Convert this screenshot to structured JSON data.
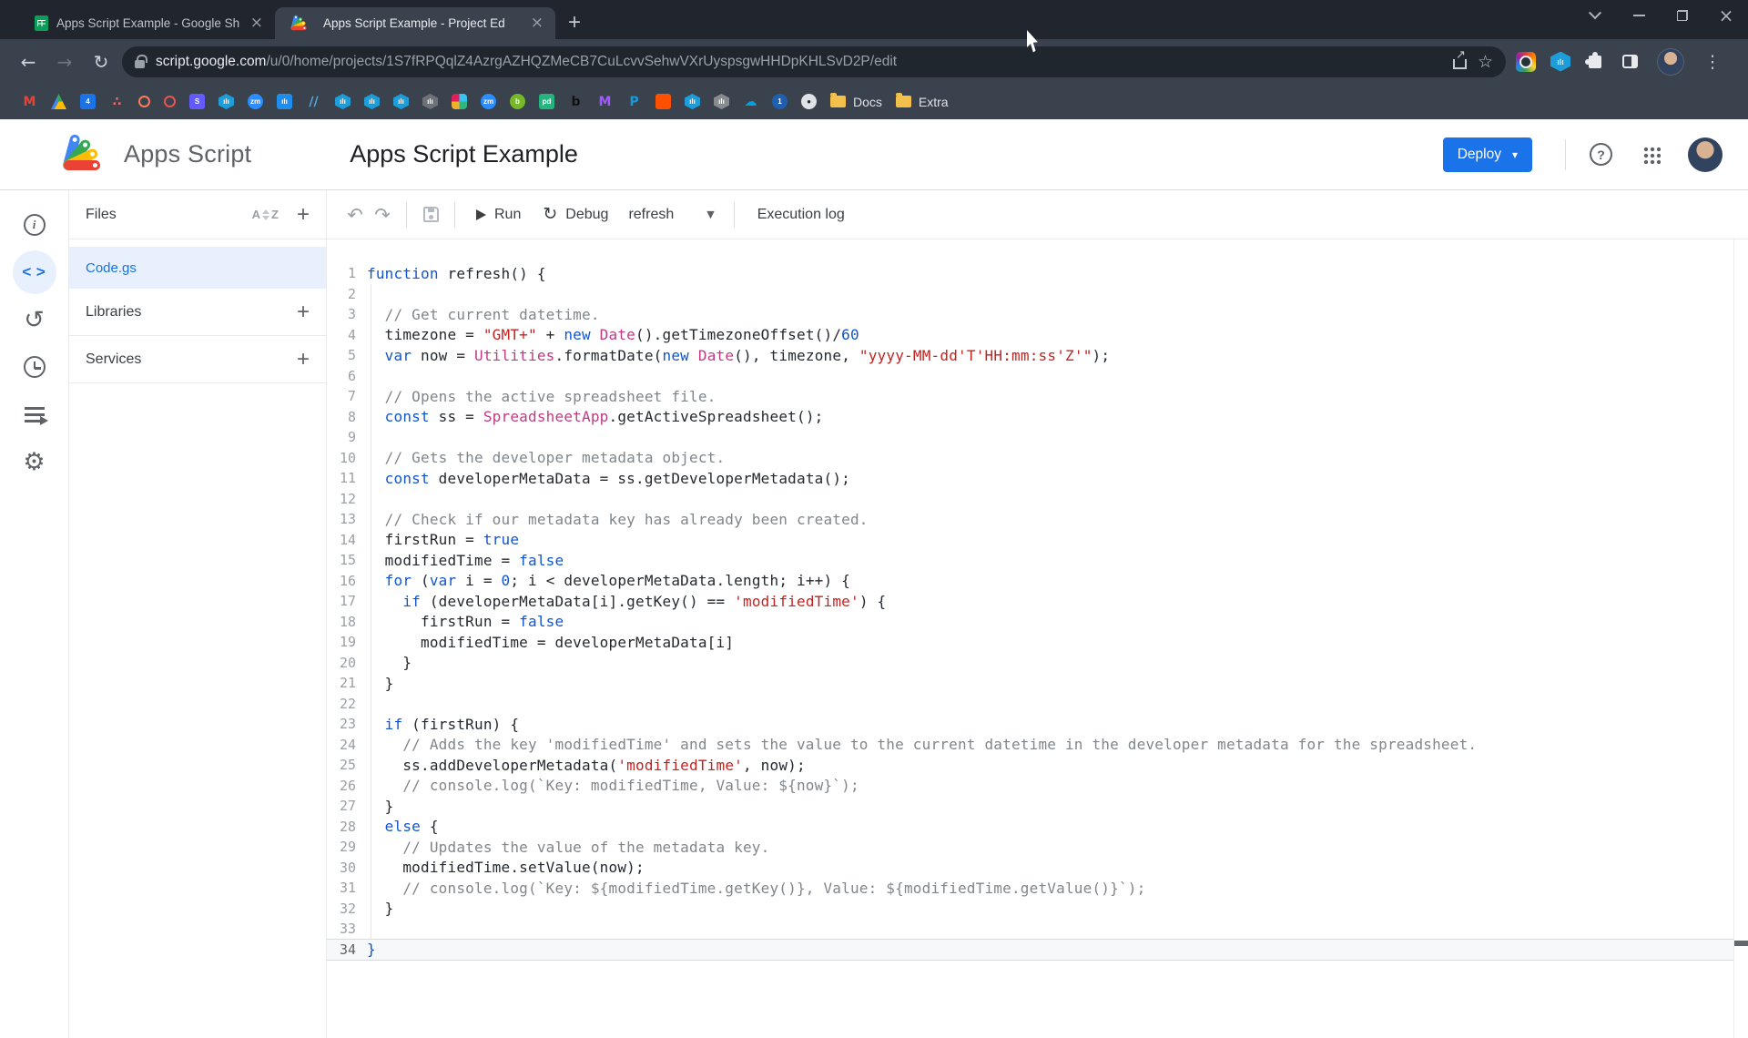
{
  "browser": {
    "tabs": [
      {
        "title": "Apps Script Example - Google Sh",
        "favicon": "google-sheets"
      },
      {
        "title": "Apps Script Example - Project Ed",
        "favicon": "apps-script",
        "active": true
      }
    ],
    "url_domain": "script.google.com",
    "url_path": "/u/0/home/projects/1S7fRPQqlZ4AzrgAZHQZMeCB7CuLcvvSehwVXrUyspsgwHHDpKHLSvD2P/edit",
    "bookmarks": [
      {
        "name": "gmail-bookmark",
        "shape": "glyphonly",
        "glyph": "M",
        "color": "#ea4335"
      },
      {
        "name": "drive-bookmark",
        "shape": "tri"
      },
      {
        "name": "calendar-bookmark",
        "shape": "square",
        "bg": "#1a73e8",
        "glyph": "4",
        "color": "#fff"
      },
      {
        "name": "asana-bookmark",
        "shape": "glyphonly",
        "glyph": "∴",
        "color": "#f06a6a"
      },
      {
        "name": "hubspot-bookmark",
        "shape": "ring",
        "border": "#ff7a59"
      },
      {
        "name": "sprocket-bookmark",
        "shape": "ring",
        "border": "#e8544f"
      },
      {
        "name": "stripe-bookmark",
        "shape": "square",
        "bg": "#635bff",
        "glyph": "S",
        "color": "#fff"
      },
      {
        "name": "databox-bookmark",
        "shape": "hex",
        "bg": "#1d9dd9",
        "glyph": "ılı",
        "color": "#fff"
      },
      {
        "name": "zoom-bookmark",
        "shape": "circle",
        "bg": "#2d8cff",
        "glyph": "zm",
        "color": "#fff"
      },
      {
        "name": "intercom-bookmark",
        "shape": "square",
        "bg": "#1f8ded",
        "glyph": "ılı",
        "color": "#fff"
      },
      {
        "name": "stripes-bookmark",
        "shape": "glyphonly",
        "glyph": "∕∕",
        "color": "#57a8dc"
      },
      {
        "name": "databox-bookmark",
        "shape": "hex",
        "bg": "#1d9dd9",
        "glyph": "ılı",
        "color": "#fff"
      },
      {
        "name": "databox-bookmark",
        "shape": "hex",
        "bg": "#1d9dd9",
        "glyph": "ılı",
        "color": "#fff"
      },
      {
        "name": "databox-bookmark",
        "shape": "hex",
        "bg": "#1d9dd9",
        "glyph": "ılı",
        "color": "#fff"
      },
      {
        "name": "databox-gray-bookmark",
        "shape": "hex",
        "bg": "#6d7278",
        "glyph": "ılı",
        "color": "#fff"
      },
      {
        "name": "slack-bookmark",
        "shape": "slack"
      },
      {
        "name": "zoom-bookmark",
        "shape": "circle",
        "bg": "#2d8cff",
        "glyph": "zm",
        "color": "#fff"
      },
      {
        "name": "basecamp-bookmark",
        "shape": "circle",
        "bg": "#76b82a",
        "glyph": "b",
        "color": "#fff"
      },
      {
        "name": "pandadoc-bookmark",
        "shape": "square",
        "bg": "#24b47e",
        "glyph": "pd",
        "color": "#fff"
      },
      {
        "name": "script-letter-bookmark",
        "shape": "glyphonly",
        "glyph": "b",
        "color": "#111111"
      },
      {
        "name": "monday-bookmark",
        "shape": "glyphonly",
        "glyph": "M",
        "color": "#a259ff"
      },
      {
        "name": "paypal-bookmark",
        "shape": "glyphonly",
        "glyph": "P",
        "color": "#169bd7"
      },
      {
        "name": "orange-square-bookmark",
        "shape": "square",
        "bg": "#ff4f00"
      },
      {
        "name": "databox-bookmark",
        "shape": "hex",
        "bg": "#1d9dd9",
        "glyph": "ılı",
        "color": "#fff"
      },
      {
        "name": "databox-gray-bookmark",
        "shape": "hex",
        "bg": "#878c91",
        "glyph": "ılı",
        "color": "#fff"
      },
      {
        "name": "salesforce-bookmark",
        "shape": "glyphonly",
        "glyph": "☁",
        "color": "#00a1e0"
      },
      {
        "name": "onepassword-bookmark",
        "shape": "circle",
        "bg": "#1f5fae",
        "glyph": "1",
        "color": "#fff"
      },
      {
        "name": "github-bookmark",
        "shape": "circle",
        "bg": "#dfe3e7",
        "glyph": "●",
        "color": "#24292f"
      },
      {
        "name": "docs-folder",
        "shape": "folder",
        "label": "Docs"
      },
      {
        "name": "extra-folder",
        "shape": "folder",
        "label": "Extra"
      }
    ]
  },
  "header": {
    "product": "Apps Script",
    "project_title": "Apps Script Example",
    "deploy_label": "Deploy"
  },
  "sidebar": {
    "files_label": "Files",
    "files": [
      {
        "name": "Code.gs",
        "selected": true
      }
    ],
    "libraries_label": "Libraries",
    "services_label": "Services"
  },
  "toolbar": {
    "run_label": "Run",
    "debug_label": "Debug",
    "function_selector": "refresh",
    "execution_log_label": "Execution log"
  },
  "editor": {
    "current_line": 34,
    "lines": [
      [
        [
          "kw",
          "function"
        ],
        [
          "d",
          " refresh() {"
        ]
      ],
      [],
      [
        [
          "c",
          "  // Get current datetime."
        ]
      ],
      [
        [
          "d",
          "  timezone = "
        ],
        [
          "s",
          "\"GMT+\""
        ],
        [
          "d",
          " + "
        ],
        [
          "kw",
          "new"
        ],
        [
          "d",
          " "
        ],
        [
          "t",
          "Date"
        ],
        [
          "d",
          "().getTimezoneOffset()/"
        ],
        [
          "n",
          "60"
        ]
      ],
      [
        [
          "d",
          "  "
        ],
        [
          "kw",
          "var"
        ],
        [
          "d",
          " now = "
        ],
        [
          "t",
          "Utilities"
        ],
        [
          "d",
          ".formatDate("
        ],
        [
          "kw",
          "new"
        ],
        [
          "d",
          " "
        ],
        [
          "t",
          "Date"
        ],
        [
          "d",
          "(), timezone, "
        ],
        [
          "s",
          "\"yyyy-MM-dd'T'HH:mm:ss'Z'\""
        ],
        [
          "d",
          ");"
        ]
      ],
      [],
      [
        [
          "c",
          "  // Opens the active spreadsheet file."
        ]
      ],
      [
        [
          "d",
          "  "
        ],
        [
          "kw",
          "const"
        ],
        [
          "d",
          " ss = "
        ],
        [
          "t",
          "SpreadsheetApp"
        ],
        [
          "d",
          ".getActiveSpreadsheet();"
        ]
      ],
      [],
      [
        [
          "c",
          "  // Gets the developer metadata object."
        ]
      ],
      [
        [
          "d",
          "  "
        ],
        [
          "kw",
          "const"
        ],
        [
          "d",
          " developerMetaData = ss.getDeveloperMetadata();"
        ]
      ],
      [],
      [
        [
          "c",
          "  // Check if our metadata key has already been created."
        ]
      ],
      [
        [
          "d",
          "  firstRun = "
        ],
        [
          "kw",
          "true"
        ]
      ],
      [
        [
          "d",
          "  modifiedTime = "
        ],
        [
          "kw",
          "false"
        ]
      ],
      [
        [
          "d",
          "  "
        ],
        [
          "kw",
          "for"
        ],
        [
          "d",
          " ("
        ],
        [
          "kw",
          "var"
        ],
        [
          "d",
          " i = "
        ],
        [
          "n",
          "0"
        ],
        [
          "d",
          "; i < developerMetaData.length; i++) {"
        ]
      ],
      [
        [
          "d",
          "    "
        ],
        [
          "kw",
          "if"
        ],
        [
          "d",
          " (developerMetaData[i].getKey() == "
        ],
        [
          "s",
          "'modifiedTime'"
        ],
        [
          "d",
          ") {"
        ]
      ],
      [
        [
          "d",
          "      firstRun = "
        ],
        [
          "kw",
          "false"
        ]
      ],
      [
        [
          "d",
          "      modifiedTime = developerMetaData[i]"
        ]
      ],
      [
        [
          "d",
          "    }"
        ]
      ],
      [
        [
          "d",
          "  }"
        ]
      ],
      [],
      [
        [
          "d",
          "  "
        ],
        [
          "kw",
          "if"
        ],
        [
          "d",
          " (firstRun) {"
        ]
      ],
      [
        [
          "c",
          "    // Adds the key 'modifiedTime' and sets the value to the current datetime in the developer metadata for the spreadsheet."
        ]
      ],
      [
        [
          "d",
          "    ss.addDeveloperMetadata("
        ],
        [
          "s",
          "'modifiedTime'"
        ],
        [
          "d",
          ", now);"
        ]
      ],
      [
        [
          "c",
          "    // console.log(`Key: modifiedTime, Value: ${now}`);"
        ]
      ],
      [
        [
          "d",
          "  }"
        ]
      ],
      [
        [
          "d",
          "  "
        ],
        [
          "kw",
          "else"
        ],
        [
          "d",
          " {"
        ]
      ],
      [
        [
          "c",
          "    // Updates the value of the metadata key."
        ]
      ],
      [
        [
          "d",
          "    modifiedTime.setValue(now);"
        ]
      ],
      [
        [
          "c",
          "    // console.log(`Key: ${modifiedTime.getKey()}, Value: ${modifiedTime.getValue()}`);"
        ]
      ],
      [
        [
          "d",
          "  }"
        ]
      ],
      [],
      [
        [
          "kw",
          "}"
        ]
      ]
    ]
  },
  "colors": {
    "accent_blue": "#1a73e8",
    "selected_bg": "#e8f0fe",
    "keyword": "#1155cc",
    "string": "#c5221f",
    "comment": "#80868b",
    "builtin_class": "#c03a83",
    "chrome_dark": "#21262e",
    "chrome_toolbar": "#3a424e"
  }
}
